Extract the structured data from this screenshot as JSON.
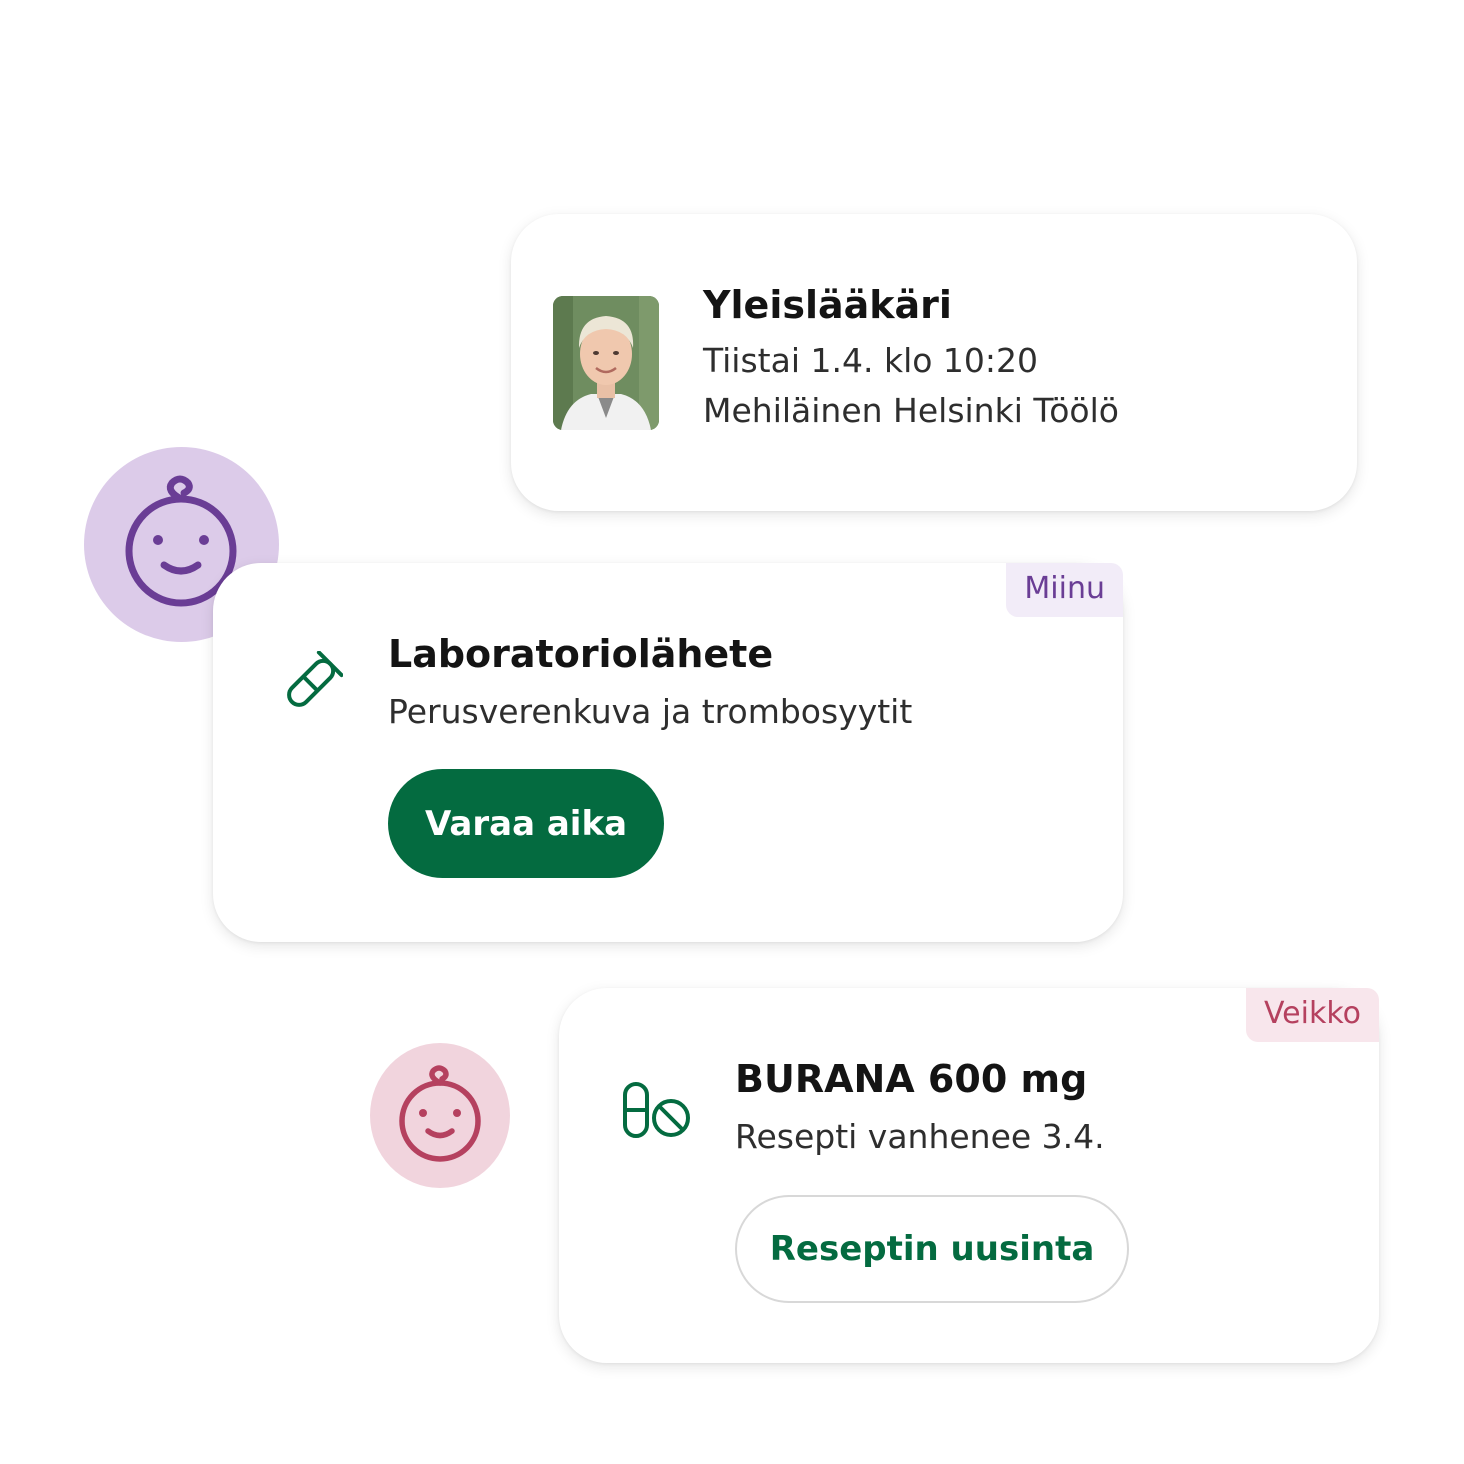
{
  "appointment": {
    "title": "Yleislääkäri",
    "datetime": "Tiistai 1.4. klo 10:20",
    "location": "Mehiläinen Helsinki Töölö"
  },
  "lab_referral": {
    "owner": "Miinu",
    "title": "Laboratoriolähete",
    "description": "Perusverenkuva ja trombosyytit",
    "button_label": "Varaa aika"
  },
  "prescription": {
    "owner": "Veikko",
    "title": "BURANA 600 mg",
    "description": "Resepti vanhenee 3.4.",
    "button_label": "Reseptin uusinta"
  },
  "icons": {
    "lab": "test-tube-icon",
    "prescription": "pills-icon",
    "avatar": "baby-face-icon"
  },
  "colors": {
    "primary_green": "#046b40",
    "miinu_accent": "#6a3d95",
    "miinu_bg": "#dccbe9",
    "veikko_accent": "#b5415f",
    "veikko_bg": "#f1d4dd"
  }
}
